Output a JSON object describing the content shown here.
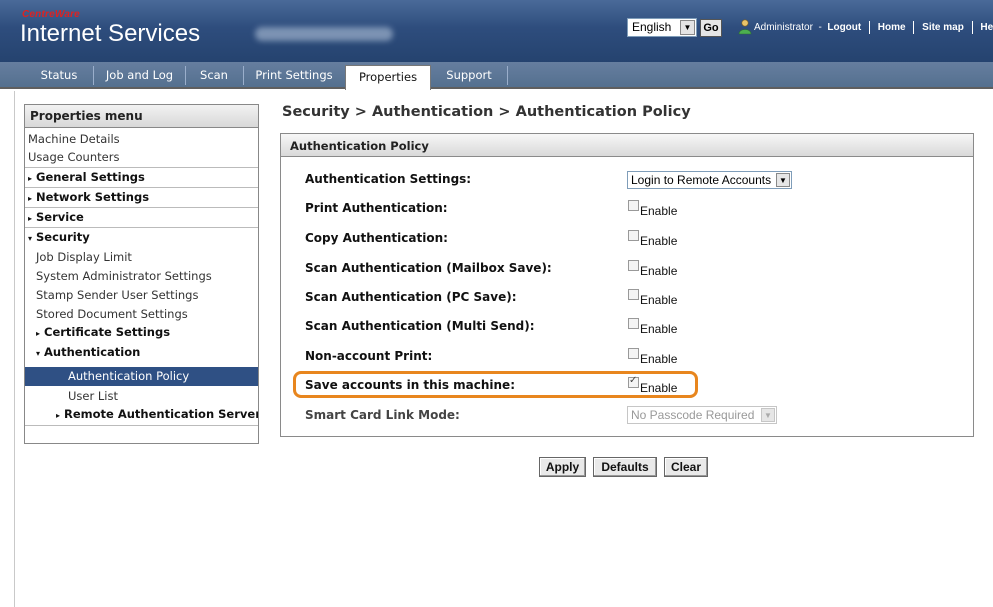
{
  "header": {
    "logo_small": "CentreWare",
    "logo_big": "Internet Services",
    "host_name": "",
    "language": "English",
    "go_label": "Go",
    "user_label": "Administrator",
    "logout_label": "Logout",
    "home_label": "Home",
    "sitemap_label": "Site map",
    "help_label": "Help..."
  },
  "tabs": [
    {
      "label": "Status"
    },
    {
      "label": "Job and Log"
    },
    {
      "label": "Scan"
    },
    {
      "label": "Print Settings"
    },
    {
      "label": "Properties",
      "active": true
    },
    {
      "label": "Support"
    }
  ],
  "sidebar": {
    "title": "Properties menu",
    "items": [
      {
        "label": "Machine Details"
      },
      {
        "label": "Usage Counters"
      },
      {
        "label": "General Settings",
        "expander": "▸"
      },
      {
        "label": "Network Settings",
        "expander": "▸"
      },
      {
        "label": "Service",
        "expander": "▸"
      },
      {
        "label": "Security",
        "expander": "▾"
      },
      {
        "label": "Job Display Limit"
      },
      {
        "label": "System Administrator Settings"
      },
      {
        "label": "Stamp Sender User Settings"
      },
      {
        "label": "Stored Document Settings"
      },
      {
        "label": "Certificate Settings",
        "expander": "▸"
      },
      {
        "label": "Authentication",
        "expander": "▾"
      },
      {
        "label": "Authentication Policy",
        "selected": true
      },
      {
        "label": "User List"
      },
      {
        "label": "Remote Authentication Servers",
        "expander": "▸"
      }
    ]
  },
  "main": {
    "breadcrumb": "Security > Authentication > Authentication Policy",
    "panel_title": "Authentication Policy",
    "rows": [
      {
        "label": "Authentication Settings:",
        "type": "select",
        "value": "Login to Remote Accounts"
      },
      {
        "label": "Print Authentication:",
        "type": "checkbox",
        "checkbox_label": "Enable",
        "checked": false
      },
      {
        "label": "Copy Authentication:",
        "type": "checkbox",
        "checkbox_label": "Enable",
        "checked": false
      },
      {
        "label": "Scan Authentication (Mailbox Save):",
        "type": "checkbox",
        "checkbox_label": "Enable",
        "checked": false
      },
      {
        "label": "Scan Authentication (PC Save):",
        "type": "checkbox",
        "checkbox_label": "Enable",
        "checked": false
      },
      {
        "label": "Scan Authentication (Multi Send):",
        "type": "checkbox",
        "checkbox_label": "Enable",
        "checked": false
      },
      {
        "label": "Non-account Print:",
        "type": "checkbox",
        "checkbox_label": "Enable",
        "checked": false
      },
      {
        "label": "Save accounts in this machine:",
        "type": "checkbox",
        "checkbox_label": "Enable",
        "checked": true,
        "highlighted": true
      },
      {
        "label": "Smart Card Link Mode:",
        "type": "select",
        "value": "No Passcode Required",
        "disabled": true
      }
    ],
    "buttons": {
      "apply": "Apply",
      "defaults": "Defaults",
      "clear": "Clear"
    }
  },
  "colors": {
    "header_blue": "#2e4d7d",
    "selected_bg": "#2f5084",
    "highlight_orange": "#e8861e"
  }
}
